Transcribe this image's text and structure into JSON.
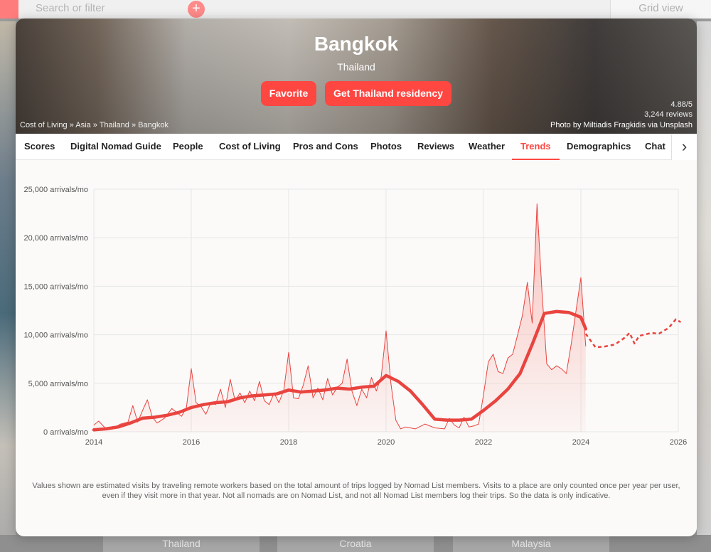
{
  "background": {
    "search_placeholder": "Search or filter",
    "grid_view": "Grid view",
    "bottom_cards": [
      "Thailand",
      "Croatia",
      "Malaysia"
    ]
  },
  "hero": {
    "city": "Bangkok",
    "country": "Thailand",
    "favorite_button": "Favorite",
    "residency_button": "Get Thailand residency",
    "breadcrumb": "Cost of Living » Asia » Thailand » Bangkok",
    "rating": "4.88/5",
    "reviews": "3,244 reviews",
    "photo_credit": {
      "prefix": "Photo by",
      "author": "Miltiadis Fragkidis",
      "via": "via",
      "source": "Unsplash"
    }
  },
  "tabs": [
    "Scores",
    "Digital Nomad Guide",
    "People",
    "Cost of Living",
    "Pros and Cons",
    "Photos",
    "Reviews",
    "Weather",
    "Trends",
    "Demographics",
    "Chat"
  ],
  "active_tab": "Trends",
  "colors": {
    "accent": "#ff4742",
    "line": "#e9443f",
    "area": "#f8b7b2"
  },
  "chart_data": {
    "type": "line",
    "title": "",
    "xlabel": "",
    "ylabel": "",
    "xlim": [
      2014,
      2026
    ],
    "ylim": [
      0,
      25000
    ],
    "x_ticks": [
      2014,
      2016,
      2018,
      2020,
      2022,
      2024,
      2026
    ],
    "y_ticks": [
      "0 arrivals/mo",
      "5,000 arrivals/mo",
      "10,000 arrivals/mo",
      "15,000 arrivals/mo",
      "20,000 arrivals/mo",
      "25,000 arrivals/mo"
    ],
    "y_tick_values": [
      0,
      5000,
      10000,
      15000,
      20000,
      25000
    ],
    "grid": true,
    "series": [
      {
        "style": "area",
        "x": [
          2014,
          2014.1,
          2014.25,
          2014.4,
          2014.55,
          2014.7,
          2014.8,
          2014.9,
          2015.0,
          2015.1,
          2015.2,
          2015.3,
          2015.45,
          2015.6,
          2015.8,
          2015.9,
          2016.0,
          2016.1,
          2016.2,
          2016.3,
          2016.4,
          2016.5,
          2016.6,
          2016.7,
          2016.8,
          2016.9,
          2017.0,
          2017.1,
          2017.2,
          2017.3,
          2017.4,
          2017.5,
          2017.6,
          2017.7,
          2017.8,
          2017.9,
          2018.0,
          2018.1,
          2018.2,
          2018.3,
          2018.4,
          2018.5,
          2018.6,
          2018.7,
          2018.8,
          2018.9,
          2019.0,
          2019.1,
          2019.2,
          2019.3,
          2019.4,
          2019.5,
          2019.6,
          2019.7,
          2019.8,
          2019.9,
          2020.0,
          2020.1,
          2020.2,
          2020.3,
          2020.4,
          2020.6,
          2020.8,
          2021.0,
          2021.2,
          2021.3,
          2021.4,
          2021.5,
          2021.6,
          2021.7,
          2021.8,
          2021.9,
          2022.0,
          2022.1,
          2022.2,
          2022.3,
          2022.4,
          2022.5,
          2022.6,
          2022.7,
          2022.8,
          2022.9,
          2023.0,
          2023.1,
          2023.2,
          2023.3,
          2023.4,
          2023.5,
          2023.6,
          2023.7,
          2023.8,
          2023.9,
          2024.0,
          2024.1
        ],
        "y": [
          700,
          1100,
          300,
          400,
          800,
          1000,
          2700,
          1000,
          2200,
          3300,
          1500,
          900,
          1400,
          2400,
          1600,
          2500,
          6500,
          3000,
          2600,
          1800,
          3000,
          2800,
          4400,
          2500,
          5400,
          3200,
          4000,
          3000,
          4200,
          3200,
          5200,
          3200,
          2800,
          4000,
          3000,
          4300,
          8200,
          3500,
          3400,
          4800,
          6800,
          3500,
          4500,
          3300,
          5500,
          3800,
          4600,
          5000,
          7500,
          4200,
          2700,
          4400,
          3500,
          5600,
          4200,
          5700,
          10400,
          5000,
          1200,
          300,
          500,
          300,
          800,
          400,
          300,
          1400,
          700,
          400,
          1500,
          500,
          600,
          800,
          3800,
          7200,
          8000,
          6200,
          6000,
          7600,
          8000,
          10000,
          12000,
          15400,
          11200,
          23500,
          14500,
          7000,
          6400,
          6800,
          6500,
          6000,
          9000,
          12500,
          15900,
          8800
        ]
      },
      {
        "style": "line",
        "x": [
          2014,
          2014.25,
          2014.5,
          2014.75,
          2015,
          2015.25,
          2015.5,
          2015.75,
          2016,
          2016.25,
          2016.5,
          2016.75,
          2017,
          2017.25,
          2017.5,
          2017.75,
          2018,
          2018.25,
          2018.5,
          2018.75,
          2019,
          2019.25,
          2019.5,
          2019.75,
          2020,
          2020.25,
          2020.5,
          2020.75,
          2021,
          2021.25,
          2021.5,
          2021.75,
          2022,
          2022.25,
          2022.5,
          2022.75,
          2023,
          2023.25,
          2023.5,
          2023.75,
          2024,
          2024.1
        ],
        "y": [
          200,
          300,
          500,
          900,
          1400,
          1500,
          1700,
          2000,
          2500,
          2800,
          3000,
          3100,
          3500,
          3700,
          3800,
          3900,
          4300,
          4100,
          4200,
          4300,
          4500,
          4400,
          4600,
          4700,
          5800,
          5200,
          4200,
          2800,
          1300,
          1200,
          1200,
          1300,
          2200,
          3200,
          4400,
          6000,
          9000,
          12200,
          12400,
          12300,
          11800,
          10600
        ]
      },
      {
        "style": "dashed",
        "x": [
          2024.1,
          2024.3,
          2024.5,
          2024.7,
          2024.9,
          2025.0,
          2025.1,
          2025.2,
          2025.3,
          2025.45,
          2025.6,
          2025.8,
          2025.95,
          2026.05
        ],
        "y": [
          10100,
          8700,
          8800,
          9000,
          9700,
          10200,
          9100,
          9900,
          10000,
          10200,
          10100,
          10700,
          11600,
          11300
        ]
      }
    ]
  },
  "footnote": "Values shown are estimated visits by traveling remote workers based on the total amount of trips logged by Nomad List members. Visits to a place are only counted once per year per user, even if they visit more in that year. Not all nomads are on Nomad List, and not all Nomad List members log their trips. So the data is only indicative."
}
